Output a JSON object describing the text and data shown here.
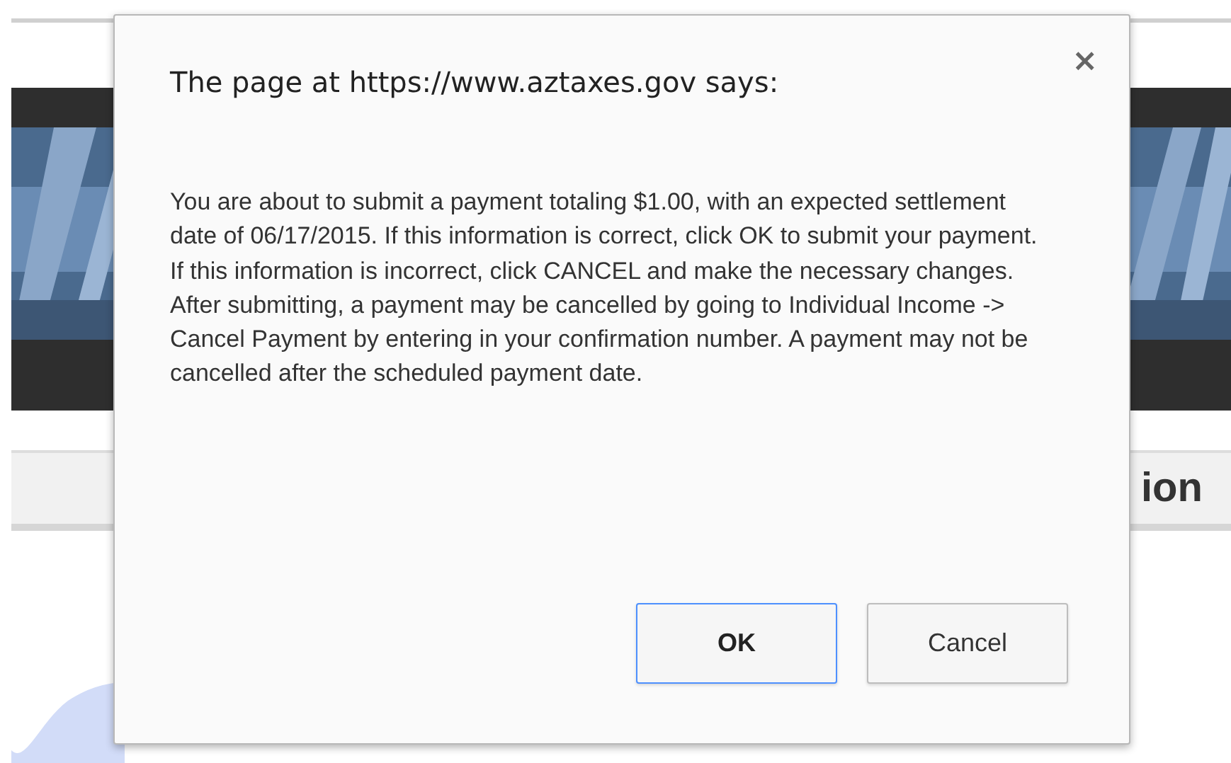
{
  "background_page": {
    "heading_fragment": "ion"
  },
  "dialog": {
    "title": "The page at https://www.aztaxes.gov says:",
    "close": "×",
    "message": "You are about to submit a payment totaling $1.00, with an expected settlement date of 06/17/2015. If this information is correct, click OK to submit your payment. If this information is incorrect, click CANCEL and make the necessary changes. After submitting, a payment may be cancelled by going to Individual Income -> Cancel Payment by entering in your confirmation number.  A payment may not be cancelled after the scheduled payment date.",
    "buttons": [
      {
        "label": "OK",
        "kind": "default"
      },
      {
        "label": "Cancel",
        "kind": "normal"
      }
    ]
  }
}
